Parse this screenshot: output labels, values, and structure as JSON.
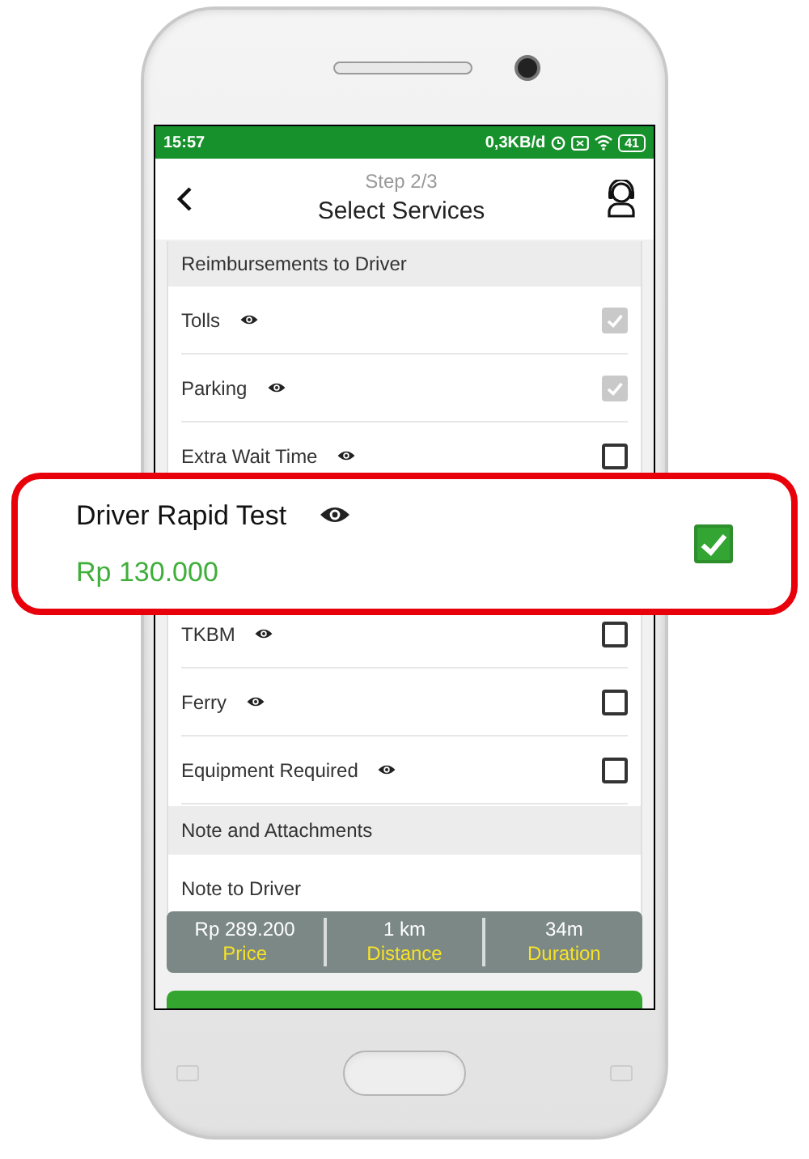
{
  "status_bar": {
    "time": "15:57",
    "network_speed": "0,3KB/d",
    "battery": "41"
  },
  "header": {
    "step": "Step 2/3",
    "title": "Select Services"
  },
  "reimbursements": {
    "title": "Reimbursements to Driver",
    "items": [
      {
        "label": "Tolls",
        "checked": true,
        "disabled": true
      },
      {
        "label": "Parking",
        "checked": true,
        "disabled": true
      },
      {
        "label": "Extra Wait Time",
        "checked": false,
        "disabled": false
      },
      {
        "label": "TKBM",
        "checked": false,
        "disabled": false
      },
      {
        "label": "Ferry",
        "checked": false,
        "disabled": false
      },
      {
        "label": "Equipment Required",
        "checked": false,
        "disabled": false
      }
    ]
  },
  "notes": {
    "title": "Note and Attachments",
    "field_label": "Note to Driver"
  },
  "summary": [
    {
      "value": "Rp 289.200",
      "label": "Price"
    },
    {
      "value": "1 km",
      "label": "Distance"
    },
    {
      "value": "34m",
      "label": "Duration"
    }
  ],
  "highlighted_item": {
    "label": "Driver Rapid Test",
    "price": "Rp 130.000",
    "checked": true,
    "disabled": false
  }
}
